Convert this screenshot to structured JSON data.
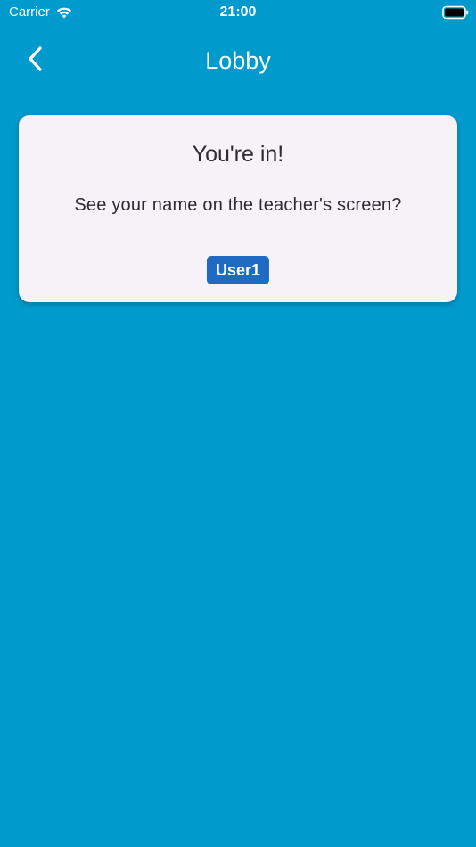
{
  "status_bar": {
    "carrier": "Carrier",
    "time": "21:00",
    "wifi_icon": "wifi-icon",
    "battery_icon": "battery-icon"
  },
  "app_bar": {
    "back_icon": "chevron-left-icon",
    "title": "Lobby"
  },
  "card": {
    "heading": "You're in!",
    "subtitle": "See your name on the teacher's screen?",
    "user_name": "User1"
  },
  "colors": {
    "background": "#009acd",
    "card_background": "#f6f2f8",
    "chip_background": "#1f6bc4",
    "text_dark": "#2f2a33"
  }
}
